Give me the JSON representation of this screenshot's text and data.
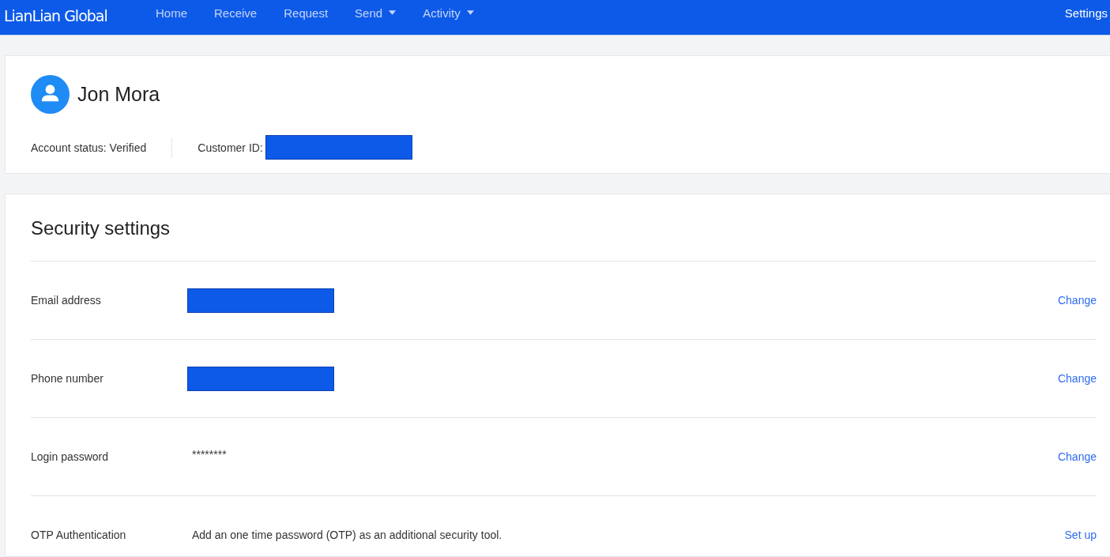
{
  "navbar": {
    "logo": "LianLian Global",
    "items": [
      {
        "label": "Home",
        "dropdown": false,
        "selected": false
      },
      {
        "label": "Receive",
        "dropdown": false,
        "selected": false
      },
      {
        "label": "Request",
        "dropdown": false,
        "selected": false
      },
      {
        "label": "Send",
        "dropdown": true,
        "selected": false
      },
      {
        "label": "Activity",
        "dropdown": true,
        "selected": false
      }
    ],
    "settings": {
      "label": "Settings",
      "selected": true
    }
  },
  "profile": {
    "name": "Jon Mora",
    "account_status": "Account status: Verified",
    "customer_id_label": "Customer ID:",
    "customer_id_redacted": true
  },
  "security": {
    "title": "Security settings",
    "rows": [
      {
        "label": "Email address",
        "kind": "redacted",
        "action": "Change"
      },
      {
        "label": "Phone number",
        "kind": "redacted",
        "action": "Change"
      },
      {
        "label": "Login password",
        "kind": "masked",
        "value": "********",
        "action": "Change"
      },
      {
        "label": "OTP Authentication",
        "kind": "text",
        "value": "Add an one time password (OTP) as an additional security tool.",
        "action": "Set up"
      }
    ]
  }
}
